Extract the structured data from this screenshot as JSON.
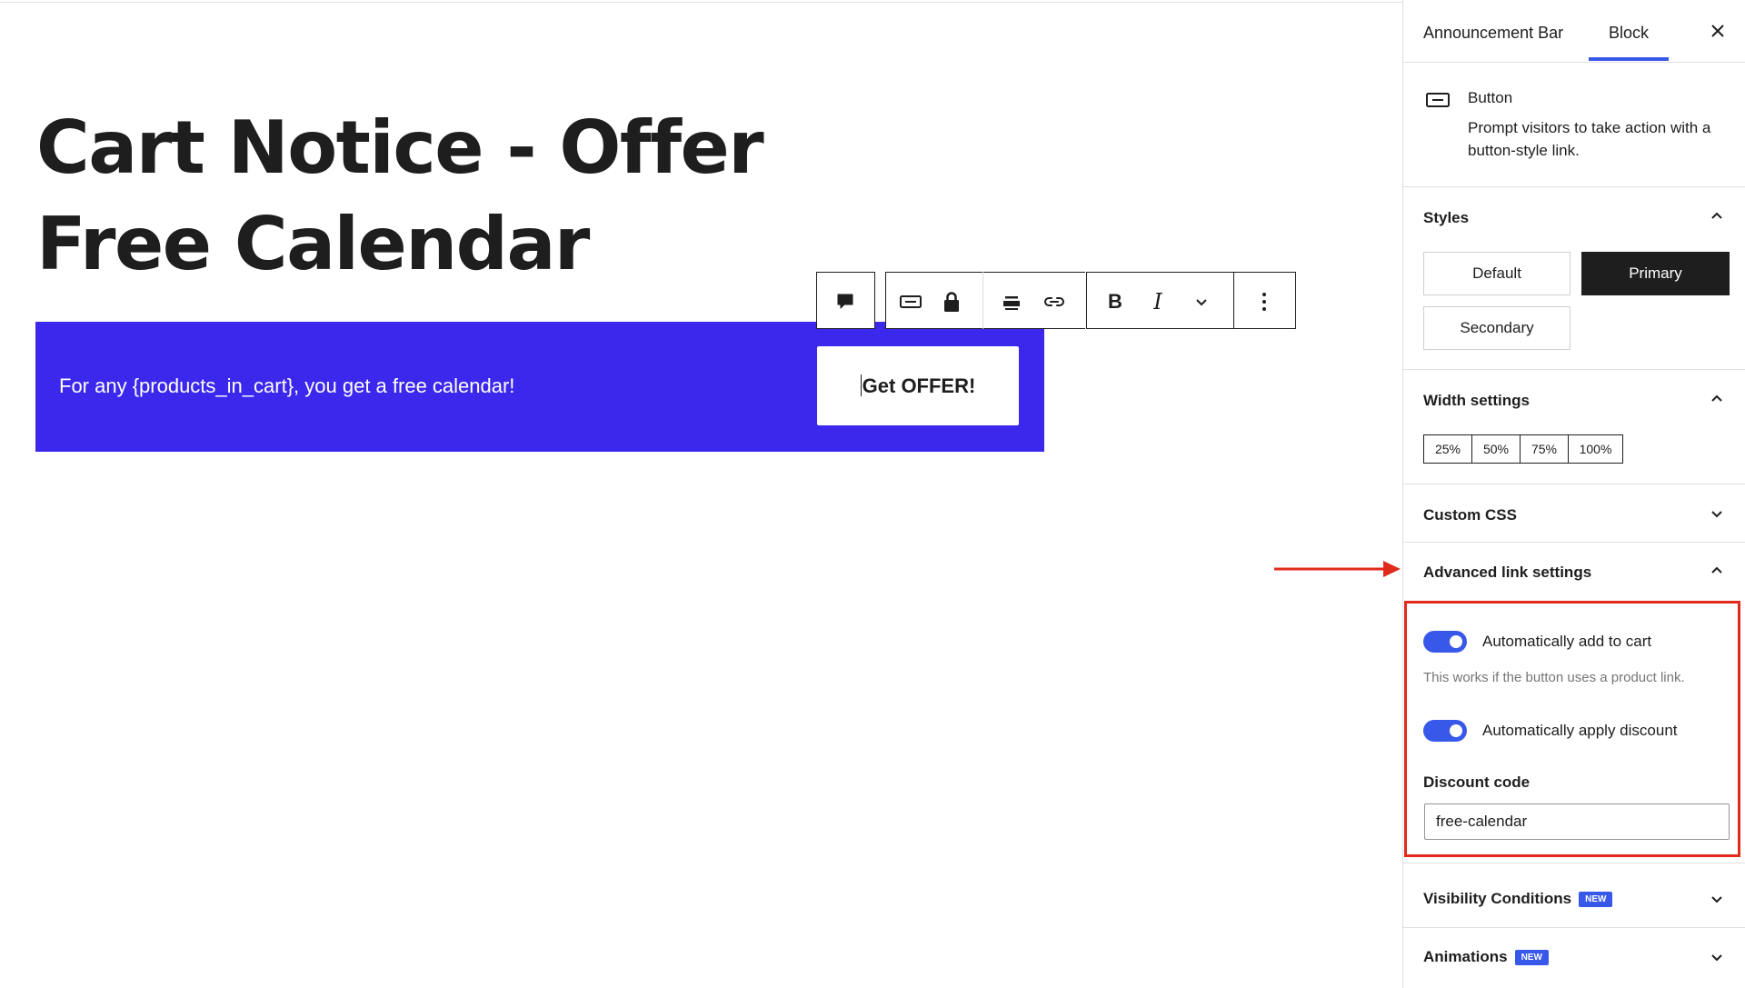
{
  "canvas": {
    "title": "Cart Notice - Offer Free Calendar",
    "banner_text": "For any {products_in_cart}, you get a free calendar!",
    "banner_button_label": "Get OFFER!",
    "banner_color": "#3c28ec"
  },
  "toolbar": {
    "buttons": [
      "comment-icon",
      "button-block-icon",
      "lock-icon",
      "justify-icon",
      "link-icon",
      "bold-icon",
      "italic-icon",
      "more-options-chevron-icon",
      "options-icon"
    ],
    "bold_label": "B",
    "italic_label": "I"
  },
  "sidebar": {
    "tabs": [
      {
        "label": "Announcement Bar"
      },
      {
        "label": "Block"
      }
    ],
    "active_tab": "Block",
    "block": {
      "name": "Button",
      "description": "Prompt visitors to take action with a button-style link."
    },
    "styles": {
      "title": "Styles",
      "options": [
        "Default",
        "Primary",
        "Secondary"
      ],
      "selected": "Primary"
    },
    "width_settings": {
      "title": "Width settings",
      "options": [
        "25%",
        "50%",
        "75%",
        "100%"
      ]
    },
    "custom_css": {
      "title": "Custom CSS"
    },
    "advanced_link": {
      "title": "Advanced link settings",
      "auto_add_to_cart": {
        "label": "Automatically add to cart",
        "checked": true
      },
      "help_text": "This works if the button uses a product link.",
      "auto_apply_discount": {
        "label": "Automatically apply discount",
        "checked": true
      },
      "discount_label": "Discount code",
      "discount_value": "free-calendar"
    },
    "visibility": {
      "title": "Visibility Conditions",
      "badge": "NEW"
    },
    "animations": {
      "title": "Animations",
      "badge": "NEW"
    }
  },
  "colors": {
    "accent": "#3858e9",
    "highlight": "#e02a1d",
    "dark": "#1e1e1e"
  }
}
